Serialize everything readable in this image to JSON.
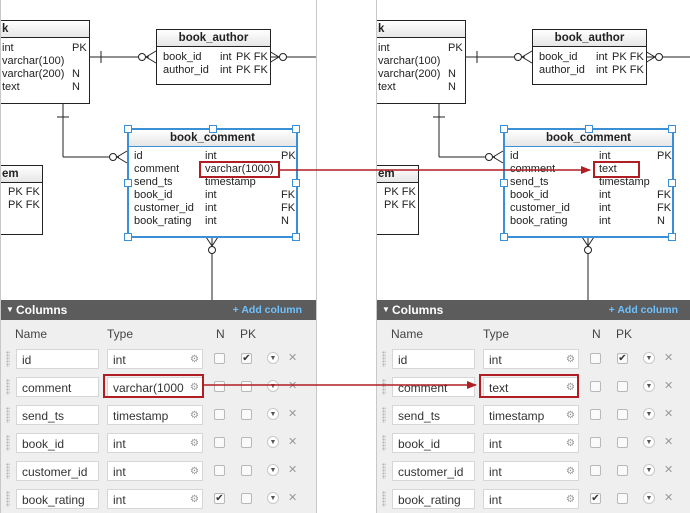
{
  "left": {
    "tables": {
      "book": {
        "name": "k",
        "rows": [
          {
            "name": "int",
            "type": "",
            "flag": "PK"
          },
          {
            "name": "varchar(100)",
            "type": "",
            "flag": ""
          },
          {
            "name": "varchar(200)",
            "type": "",
            "flag": "N"
          },
          {
            "name": "text",
            "type": "",
            "flag": "N"
          }
        ]
      },
      "book_author": {
        "name": "book_author",
        "rows": [
          {
            "name": "book_id",
            "type": "int",
            "flag": "PK FK"
          },
          {
            "name": "author_id",
            "type": "int",
            "flag": "PK FK"
          }
        ]
      },
      "book_comment": {
        "name": "book_comment",
        "rows": [
          {
            "name": "id",
            "type": "int",
            "flag": "PK"
          },
          {
            "name": "comment",
            "type": "varchar(1000)",
            "flag": ""
          },
          {
            "name": "send_ts",
            "type": "timestamp",
            "flag": ""
          },
          {
            "name": "book_id",
            "type": "int",
            "flag": "FK"
          },
          {
            "name": "customer_id",
            "type": "int",
            "flag": "FK"
          },
          {
            "name": "book_rating",
            "type": "int",
            "flag": "N"
          }
        ]
      },
      "item": {
        "name": "em",
        "rows": [
          {
            "name": "PK FK",
            "type": "",
            "flag": ""
          },
          {
            "name": "PK FK",
            "type": "",
            "flag": ""
          }
        ]
      }
    },
    "columns_panel": {
      "title": "Columns",
      "add_label": "+ Add column",
      "header_name": "Name",
      "header_type": "Type",
      "header_n": "N",
      "header_pk": "PK",
      "rows": [
        {
          "name": "id",
          "type": "int",
          "n": false,
          "pk": true
        },
        {
          "name": "comment",
          "type": "varchar(1000",
          "n": false,
          "pk": false
        },
        {
          "name": "send_ts",
          "type": "timestamp",
          "n": false,
          "pk": false
        },
        {
          "name": "book_id",
          "type": "int",
          "n": false,
          "pk": false
        },
        {
          "name": "customer_id",
          "type": "int",
          "n": false,
          "pk": false
        },
        {
          "name": "book_rating",
          "type": "int",
          "n": true,
          "pk": false
        }
      ]
    }
  },
  "right": {
    "tables": {
      "book": {
        "name": "k",
        "rows": [
          {
            "name": "int",
            "type": "",
            "flag": "PK"
          },
          {
            "name": "varchar(100)",
            "type": "",
            "flag": ""
          },
          {
            "name": "varchar(200)",
            "type": "",
            "flag": "N"
          },
          {
            "name": "text",
            "type": "",
            "flag": "N"
          }
        ]
      },
      "book_author": {
        "name": "book_author",
        "rows": [
          {
            "name": "book_id",
            "type": "int",
            "flag": "PK FK"
          },
          {
            "name": "author_id",
            "type": "int",
            "flag": "PK FK"
          }
        ]
      },
      "book_comment": {
        "name": "book_comment",
        "rows": [
          {
            "name": "id",
            "type": "int",
            "flag": "PK"
          },
          {
            "name": "comment",
            "type": "text",
            "flag": ""
          },
          {
            "name": "send_ts",
            "type": "timestamp",
            "flag": ""
          },
          {
            "name": "book_id",
            "type": "int",
            "flag": "FK"
          },
          {
            "name": "customer_id",
            "type": "int",
            "flag": "FK"
          },
          {
            "name": "book_rating",
            "type": "int",
            "flag": "N"
          }
        ]
      },
      "item": {
        "name": "em",
        "rows": [
          {
            "name": "PK FK",
            "type": "",
            "flag": ""
          },
          {
            "name": "PK FK",
            "type": "",
            "flag": ""
          }
        ]
      }
    },
    "columns_panel": {
      "title": "Columns",
      "add_label": "+ Add column",
      "header_name": "Name",
      "header_type": "Type",
      "header_n": "N",
      "header_pk": "PK",
      "rows": [
        {
          "name": "id",
          "type": "int",
          "n": false,
          "pk": true
        },
        {
          "name": "comment",
          "type": "text",
          "n": false,
          "pk": false
        },
        {
          "name": "send_ts",
          "type": "timestamp",
          "n": false,
          "pk": false
        },
        {
          "name": "book_id",
          "type": "int",
          "n": false,
          "pk": false
        },
        {
          "name": "customer_id",
          "type": "int",
          "n": false,
          "pk": false
        },
        {
          "name": "book_rating",
          "type": "int",
          "n": true,
          "pk": false
        }
      ]
    }
  },
  "colors": {
    "highlight": "#b01e24",
    "selection": "#3a8fd6",
    "panel_header": "#5c5c5c",
    "add_link": "#6fc2ff"
  },
  "icons": {
    "gear": "gear-icon",
    "dropdown": "chevron-down-icon",
    "delete": "close-icon",
    "grip": "drag-handle-icon",
    "collapse": "triangle-down-icon",
    "check": "checkmark-icon"
  }
}
